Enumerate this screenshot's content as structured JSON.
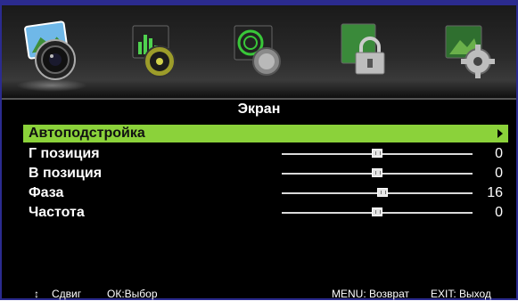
{
  "icons": [
    {
      "name": "picture-icon"
    },
    {
      "name": "sound-icon"
    },
    {
      "name": "channel-icon"
    },
    {
      "name": "lock-icon"
    },
    {
      "name": "settings-icon"
    }
  ],
  "menu": {
    "title": "Экран",
    "items": [
      {
        "label": "Автоподстройка",
        "selected": true
      },
      {
        "label": "Г позиция",
        "value": "0",
        "level": 0.5
      },
      {
        "label": "В позиция",
        "value": "0",
        "level": 0.5
      },
      {
        "label": "Фаза",
        "value": "16",
        "level": 0.53
      },
      {
        "label": "Частота",
        "value": "0",
        "level": 0.5
      }
    ]
  },
  "footer": {
    "move_symbol": "↕",
    "move": "Сдвиг",
    "ok": "ОК:Выбор",
    "menu_back": "MENU: Возврат",
    "exit": "EXIT: Выход"
  },
  "colors": {
    "selected": "#8bd23a",
    "frame": "#2b2b8f"
  }
}
